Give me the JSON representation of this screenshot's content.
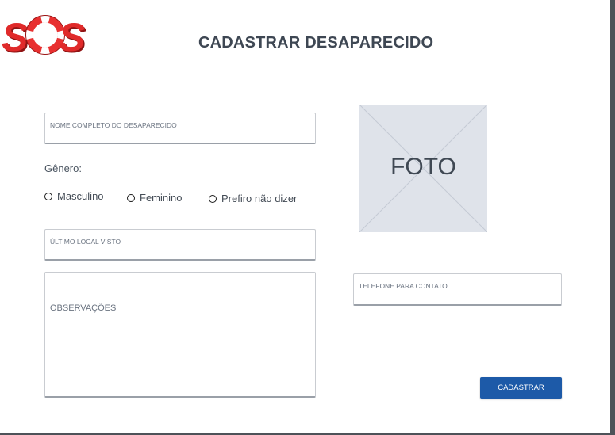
{
  "logo": {
    "text": "SOS"
  },
  "page": {
    "title": "CADASTRAR DESAPARECIDO"
  },
  "form": {
    "name_placeholder": "NOME COMPLETO DO DESAPARECIDO",
    "gender_label": "Gênero:",
    "gender_options": [
      "Masculino",
      "Feminino",
      "Prefiro não dizer"
    ],
    "last_place_placeholder": "ÚLTIMO LOCAL VISTO",
    "notes_placeholder": "OBSERVAÇÕES",
    "phone_placeholder": "TELEFONE PARA CONTATO",
    "submit_label": "CADASTRAR"
  },
  "photo": {
    "label": "FOTO"
  },
  "colors": {
    "accent": "#1d5aa8",
    "logo_red": "#e02a2a",
    "photo_bg": "#dfe3ea"
  }
}
